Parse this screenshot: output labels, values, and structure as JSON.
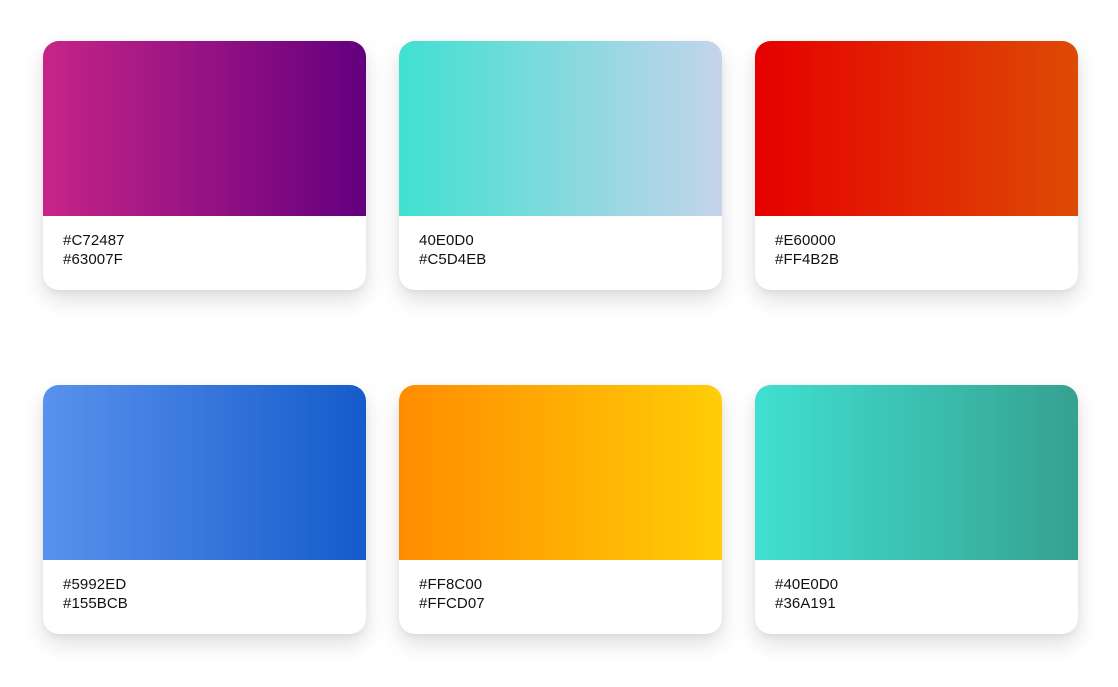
{
  "cards": [
    {
      "from": "#C72487",
      "to": "#63007F",
      "label_from": "#C72487",
      "label_to": "#63007F"
    },
    {
      "from": "#40E0D0",
      "to": "#C5D4EB",
      "label_from": "40E0D0",
      "label_to": "#C5D4EB"
    },
    {
      "from": "#E60000",
      "to": "#DD4B05",
      "label_from": "#E60000",
      "label_to": "#FF4B2B"
    },
    {
      "from": "#5992ED",
      "to": "#155BCB",
      "label_from": "#5992ED",
      "label_to": "#155BCB"
    },
    {
      "from": "#FF8C00",
      "to": "#FFCD07",
      "label_from": "#FF8C00",
      "label_to": "#FFCD07"
    },
    {
      "from": "#40E0D0",
      "to": "#36A191",
      "label_from": "#40E0D0",
      "label_to": "#36A191"
    }
  ]
}
